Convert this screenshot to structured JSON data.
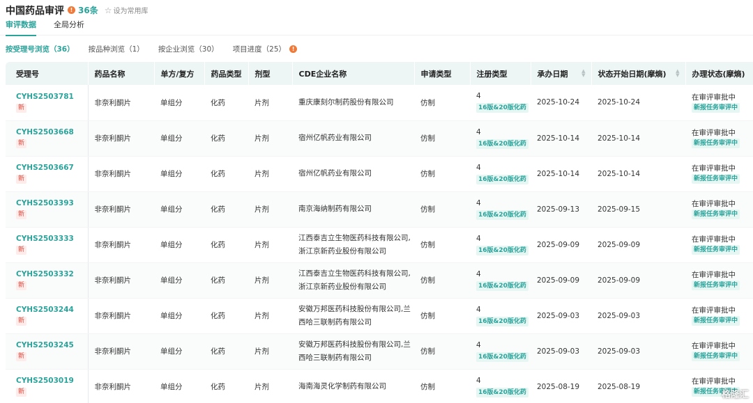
{
  "header": {
    "title": "中国药品审评",
    "count": "36条",
    "favorite_label": "设为常用库"
  },
  "tabs": [
    {
      "label": "审评数据"
    },
    {
      "label": "全局分析"
    }
  ],
  "subtabs": [
    {
      "label": "按受理号浏览（36）"
    },
    {
      "label": "按品种浏览（1）"
    },
    {
      "label": "按企业浏览（30）"
    },
    {
      "label": "项目进度（25）"
    }
  ],
  "table": {
    "columns": [
      "受理号",
      "药品名称",
      "单方/复方",
      "药品类型",
      "剂型",
      "CDE企业名称",
      "申请类型",
      "注册类型",
      "承办日期",
      "状态开始日期(摩熵)",
      "办理状态(摩熵)"
    ],
    "new_tag": "新",
    "rows": [
      {
        "id": "CYHS2503781",
        "drug": "非奈利酮片",
        "combo": "单组分",
        "type": "化药",
        "form": "片剂",
        "company": "重庆康刻尔制药股份有限公司",
        "apply": "仿制",
        "reg_num": "4",
        "reg_tag": "16版&20版化药",
        "date": "2025-10-24",
        "start": "2025-10-24",
        "status": "在审评审批中",
        "status_tag": "新报任务审评中"
      },
      {
        "id": "CYHS2503668",
        "drug": "非奈利酮片",
        "combo": "单组分",
        "type": "化药",
        "form": "片剂",
        "company": "宿州亿帆药业有限公司",
        "apply": "仿制",
        "reg_num": "4",
        "reg_tag": "16版&20版化药",
        "date": "2025-10-14",
        "start": "2025-10-14",
        "status": "在审评审批中",
        "status_tag": "新报任务审评中"
      },
      {
        "id": "CYHS2503667",
        "drug": "非奈利酮片",
        "combo": "单组分",
        "type": "化药",
        "form": "片剂",
        "company": "宿州亿帆药业有限公司",
        "apply": "仿制",
        "reg_num": "4",
        "reg_tag": "16版&20版化药",
        "date": "2025-10-14",
        "start": "2025-10-14",
        "status": "在审评审批中",
        "status_tag": "新报任务审评中"
      },
      {
        "id": "CYHS2503393",
        "drug": "非奈利酮片",
        "combo": "单组分",
        "type": "化药",
        "form": "片剂",
        "company": "南京海纳制药有限公司",
        "apply": "仿制",
        "reg_num": "4",
        "reg_tag": "16版&20版化药",
        "date": "2025-09-13",
        "start": "2025-09-15",
        "status": "在审评审批中",
        "status_tag": "新报任务审评中"
      },
      {
        "id": "CYHS2503333",
        "drug": "非奈利酮片",
        "combo": "单组分",
        "type": "化药",
        "form": "片剂",
        "company": "江西泰吉立生物医药科技有限公司,浙江京新药业股份有限公司",
        "apply": "仿制",
        "reg_num": "4",
        "reg_tag": "16版&20版化药",
        "date": "2025-09-09",
        "start": "2025-09-09",
        "status": "在审评审批中",
        "status_tag": "新报任务审评中"
      },
      {
        "id": "CYHS2503332",
        "drug": "非奈利酮片",
        "combo": "单组分",
        "type": "化药",
        "form": "片剂",
        "company": "江西泰吉立生物医药科技有限公司,浙江京新药业股份有限公司",
        "apply": "仿制",
        "reg_num": "4",
        "reg_tag": "16版&20版化药",
        "date": "2025-09-09",
        "start": "2025-09-09",
        "status": "在审评审批中",
        "status_tag": "新报任务审评中"
      },
      {
        "id": "CYHS2503244",
        "drug": "非奈利酮片",
        "combo": "单组分",
        "type": "化药",
        "form": "片剂",
        "company": "安徽万邦医药科技股份有限公司,兰西哈三联制药有限公司",
        "apply": "仿制",
        "reg_num": "4",
        "reg_tag": "16版&20版化药",
        "date": "2025-09-03",
        "start": "2025-09-03",
        "status": "在审评审批中",
        "status_tag": "新报任务审评中"
      },
      {
        "id": "CYHS2503245",
        "drug": "非奈利酮片",
        "combo": "单组分",
        "type": "化药",
        "form": "片剂",
        "company": "安徽万邦医药科技股份有限公司,兰西哈三联制药有限公司",
        "apply": "仿制",
        "reg_num": "4",
        "reg_tag": "16版&20版化药",
        "date": "2025-09-03",
        "start": "2025-09-03",
        "status": "在审评审批中",
        "status_tag": "新报任务审评中"
      },
      {
        "id": "CYHS2503019",
        "drug": "非奈利酮片",
        "combo": "单组分",
        "type": "化药",
        "form": "片剂",
        "company": "海南海灵化学制药有限公司",
        "apply": "仿制",
        "reg_num": "4",
        "reg_tag": "16版&20版化药",
        "date": "2025-08-19",
        "start": "2025-08-19",
        "status": "在审评审批中",
        "status_tag": "新报任务审评中"
      }
    ]
  },
  "watermark": "格隆汇",
  "colors": {
    "accent": "#2aa39a",
    "new_tag": "#e5483c",
    "info": "#f07a3a",
    "header_bg": "#edf5f5"
  }
}
